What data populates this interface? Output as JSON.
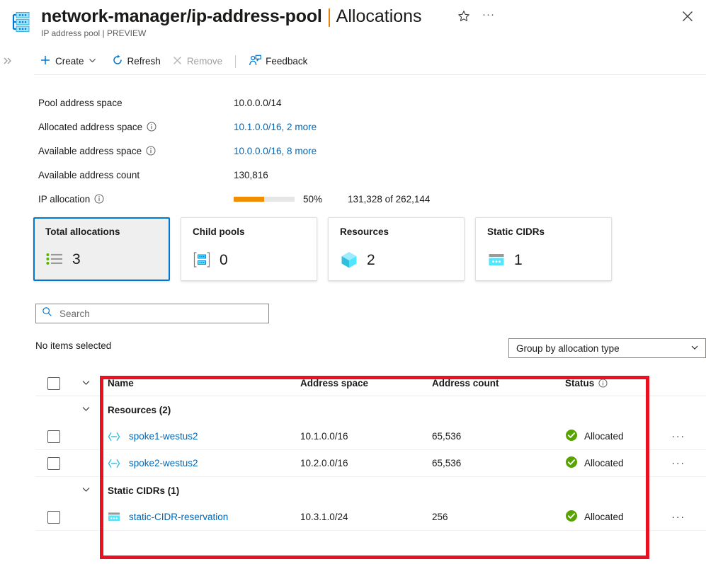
{
  "header": {
    "resource_icon": "ip-address-pool-icon",
    "title_main": "network-manager/ip-address-pool",
    "title_section": "Allocations",
    "subtitle": "IP address pool | PREVIEW",
    "favorite_icon": "star-icon",
    "more_label": "···",
    "close_icon": "close-icon",
    "accent_color": "#e8820c"
  },
  "nav": {
    "expand_icon": "double-chevron-right-icon"
  },
  "toolbar": {
    "create_label": "Create",
    "create_caret_icon": "chevron-down-icon",
    "refresh_label": "Refresh",
    "remove_label": "Remove",
    "feedback_label": "Feedback",
    "remove_disabled": true
  },
  "properties": [
    {
      "label": "Pool address space",
      "info": false,
      "value": "10.0.0.0/14",
      "link": false
    },
    {
      "label": "Allocated address space",
      "info": true,
      "value": "10.1.0.0/16, 2 more",
      "link": true
    },
    {
      "label": "Available address space",
      "info": true,
      "value": "10.0.0.0/16, 8 more",
      "link": true
    },
    {
      "label": "Available address count",
      "info": false,
      "value": "130,816",
      "link": false
    }
  ],
  "ip_allocation": {
    "label": "IP allocation",
    "percent_text": "50%",
    "percent_value": 50,
    "absolute": "131,328 of 262,144",
    "bar_color": "#f28d00",
    "track_color": "#e6e6e6"
  },
  "cards": [
    {
      "title": "Total allocations",
      "value": "3",
      "icon": "bulleted-list-icon",
      "selected": true
    },
    {
      "title": "Child pools",
      "value": "0",
      "icon": "ip-pool-icon",
      "selected": false
    },
    {
      "title": "Resources",
      "value": "2",
      "icon": "cube-icon",
      "selected": false
    },
    {
      "title": "Static CIDRs",
      "value": "1",
      "icon": "static-cidr-icon",
      "selected": false
    }
  ],
  "search": {
    "placeholder": "Search",
    "value": "",
    "icon": "search-icon"
  },
  "selection_status": "No items selected",
  "group_by": {
    "value": "Group by allocation type",
    "caret_icon": "chevron-down-icon"
  },
  "table": {
    "columns": [
      {
        "key": "name",
        "label": "Name",
        "info": false
      },
      {
        "key": "space",
        "label": "Address space",
        "info": false
      },
      {
        "key": "count",
        "label": "Address count",
        "info": false
      },
      {
        "key": "status",
        "label": "Status",
        "info": true
      }
    ],
    "groups": [
      {
        "label": "Resources (2)",
        "rows": [
          {
            "name": "spoke1-westus2",
            "icon": "virtual-network-icon",
            "space": "10.1.0.0/16",
            "count": "65,536",
            "status": "Allocated"
          },
          {
            "name": "spoke2-westus2",
            "icon": "virtual-network-icon",
            "space": "10.2.0.0/16",
            "count": "65,536",
            "status": "Allocated"
          }
        ]
      },
      {
        "label": "Static CIDRs (1)",
        "rows": [
          {
            "name": "static-CIDR-reservation",
            "icon": "static-cidr-icon",
            "space": "10.3.1.0/24",
            "count": "256",
            "status": "Allocated"
          }
        ]
      }
    ],
    "more_label": "···",
    "status_ok_color": "#57a300"
  },
  "annotation": {
    "color": "#e81123",
    "shape": "rectangle"
  }
}
